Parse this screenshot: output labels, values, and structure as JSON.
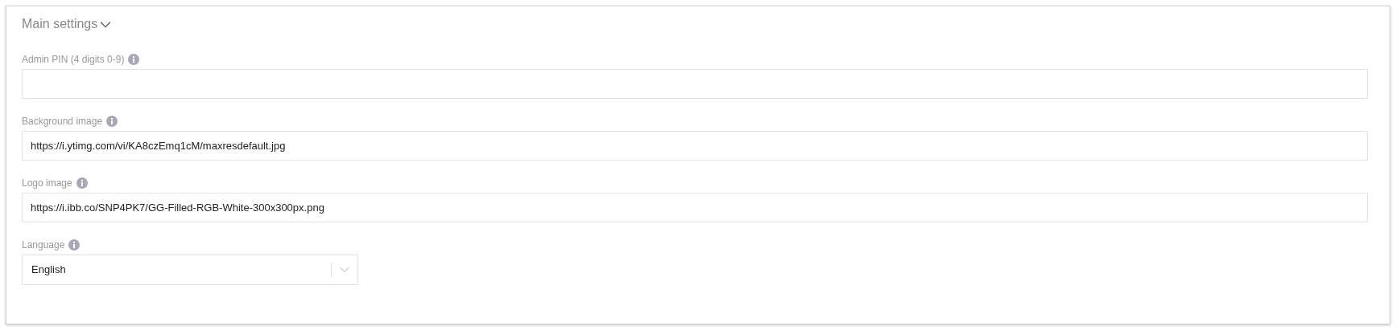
{
  "section": {
    "title": "Main settings",
    "expanded": true
  },
  "fields": [
    {
      "kind": "text",
      "label": "Admin PIN (4 digits 0-9)"
    },
    {
      "kind": "text",
      "label": "Background image",
      "value": "https://i.ytimg.com/vi/KA8czEmq1cM/maxresdefault.jpg"
    },
    {
      "kind": "text",
      "label": "Logo image",
      "value": "https://i.ibb.co/SNP4PK7/GG-Filled-RGB-White-300x300px.png"
    },
    {
      "kind": "select",
      "label": "Language",
      "value": "English"
    }
  ]
}
